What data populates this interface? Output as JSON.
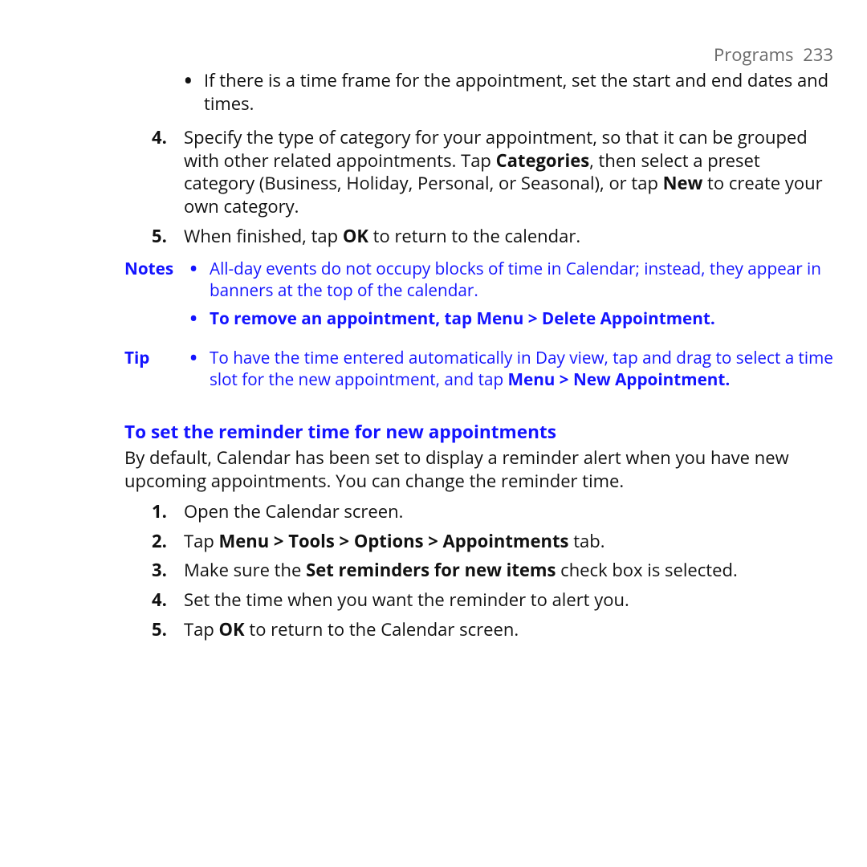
{
  "header": {
    "section": "Programs",
    "page": "233"
  },
  "cont_bullet": "If there is a time frame for the appointment, set the start and end dates and times.",
  "main_items": [
    {
      "n": "4.",
      "parts": [
        {
          "t": "Specify the type of category for your appointment, so that it can be grouped with other related appointments. Tap "
        },
        {
          "t": "Categories",
          "b": true
        },
        {
          "t": ", then select a preset category (Business, Holiday, Personal, or Seasonal), or tap "
        },
        {
          "t": "New",
          "b": true
        },
        {
          "t": " to create your own category."
        }
      ]
    },
    {
      "n": "5.",
      "parts": [
        {
          "t": "When finished, tap "
        },
        {
          "t": "OK",
          "b": true
        },
        {
          "t": " to return to the calendar."
        }
      ]
    }
  ],
  "notes": {
    "label": "Notes",
    "items": [
      {
        "bold": false,
        "parts": [
          {
            "t": "All-day events do not occupy blocks of time in Calendar; instead, they appear in banners at the top of the calendar."
          }
        ]
      },
      {
        "bold": true,
        "parts": [
          {
            "t": "To remove an appointment, tap "
          },
          {
            "t": "Menu > Delete Appointment",
            "b": true
          },
          {
            "t": "."
          }
        ]
      }
    ]
  },
  "tip": {
    "label": "Tip",
    "parts": [
      {
        "t": "To have the time entered automatically in Day view, tap and drag to select a time slot for the new appointment, and tap "
      },
      {
        "t": "Menu > New Appointment.",
        "b": true
      }
    ]
  },
  "heading": "To set the reminder time for new appointments",
  "intro": "By default, Calendar has been set to display a reminder alert when you have new upcoming appointments. You can change the reminder time.",
  "steps": [
    {
      "n": "1.",
      "parts": [
        {
          "t": "Open the Calendar screen."
        }
      ]
    },
    {
      "n": "2.",
      "parts": [
        {
          "t": "Tap "
        },
        {
          "t": "Menu > Tools > Options > Appointments",
          "b": true
        },
        {
          "t": " tab."
        }
      ]
    },
    {
      "n": "3.",
      "parts": [
        {
          "t": "Make sure the "
        },
        {
          "t": "Set reminders for new items",
          "b": true
        },
        {
          "t": " check box is selected."
        }
      ]
    },
    {
      "n": "4.",
      "parts": [
        {
          "t": "Set the time when you want the reminder to alert you."
        }
      ]
    },
    {
      "n": "5.",
      "parts": [
        {
          "t": "Tap "
        },
        {
          "t": "OK",
          "b": true
        },
        {
          "t": " to return to the Calendar screen."
        }
      ]
    }
  ]
}
